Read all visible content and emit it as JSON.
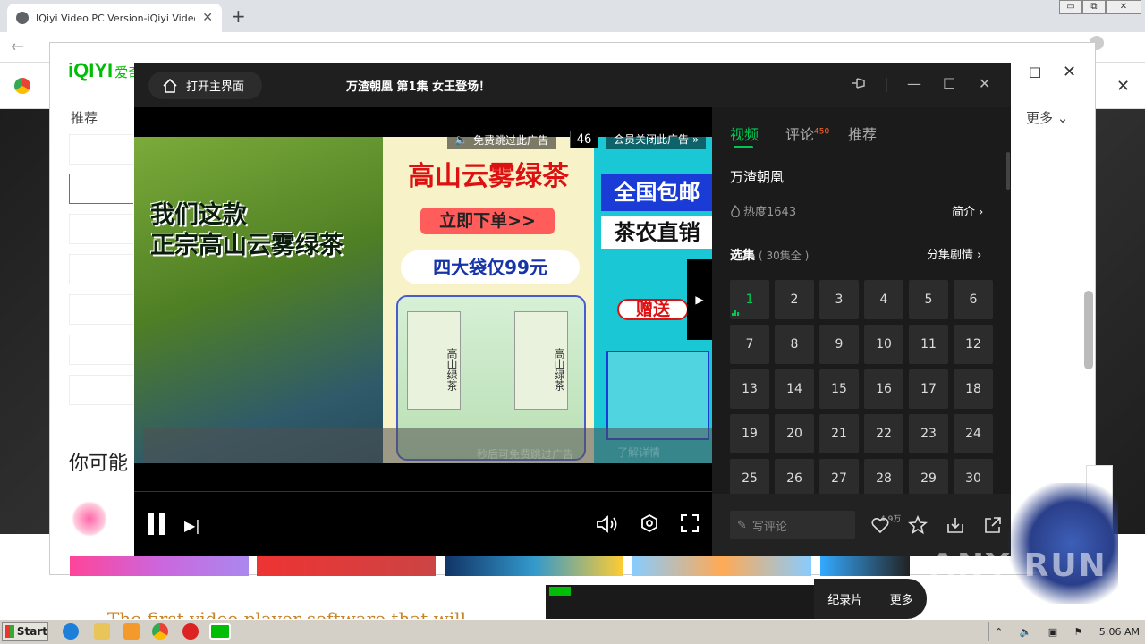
{
  "browser": {
    "tab_title": "IQiyi Video PC Version-iQiyi Video Of",
    "tab_close": "✕",
    "new_tab": "+",
    "win_min": "▭",
    "win_restore": "⧉",
    "win_close": "✕"
  },
  "client": {
    "logo": "iQIYI",
    "logo_cn": "爱奇",
    "recommend": "推荐",
    "you_may": "你可能",
    "more": "更多",
    "max": "☐",
    "close": "✕",
    "promo_text": "The first video player software that will"
  },
  "player": {
    "home_label": "打开主界面",
    "title": "万渣朝凰 第1集 女王登场！",
    "pin_icon": "pin-icon",
    "separator": "|",
    "min": "—",
    "max": "☐",
    "close": "✕"
  },
  "ad": {
    "left_text": "我们这款\n正宗高山云雾绿茶",
    "mid_title": "高山云雾绿茶",
    "mid_order": "立即下单>>",
    "mid_price": "四大袋仅99元",
    "pack_label": "高山绿茶",
    "right_t1": "全国包邮",
    "right_t2": "茶农直销",
    "right_gift": "赠送",
    "top_skip": "免费跳过此广告",
    "countdown": "46",
    "vip_close": "会员关闭此广告 »",
    "bottom_hint": "秒后可免费跳过广告",
    "learn_more": "了解详情",
    "arrow": "▶"
  },
  "side": {
    "tabs": [
      "视频",
      "评论",
      "推荐"
    ],
    "comment_count": "450",
    "show_name": "万渣朝凰",
    "heat": "热度1643",
    "intro": "简介",
    "episodes_label": "选集",
    "episodes_total": "( 30集全 )",
    "plot": "分集剧情",
    "episodes": [
      "1",
      "2",
      "3",
      "4",
      "5",
      "6",
      "7",
      "8",
      "9",
      "10",
      "11",
      "12",
      "13",
      "14",
      "15",
      "16",
      "17",
      "18",
      "19",
      "20",
      "21",
      "22",
      "23",
      "24",
      "25",
      "26",
      "27",
      "28",
      "29",
      "30"
    ],
    "current_episode": "1",
    "comment_placeholder": "写评论",
    "like_count": "4.9万"
  },
  "bottom": {
    "doc_label": "纪录片",
    "doc_more": "更多",
    "watermark": "ANY RUN"
  },
  "taskbar": {
    "start": "Start",
    "time": "5:06 AM"
  }
}
